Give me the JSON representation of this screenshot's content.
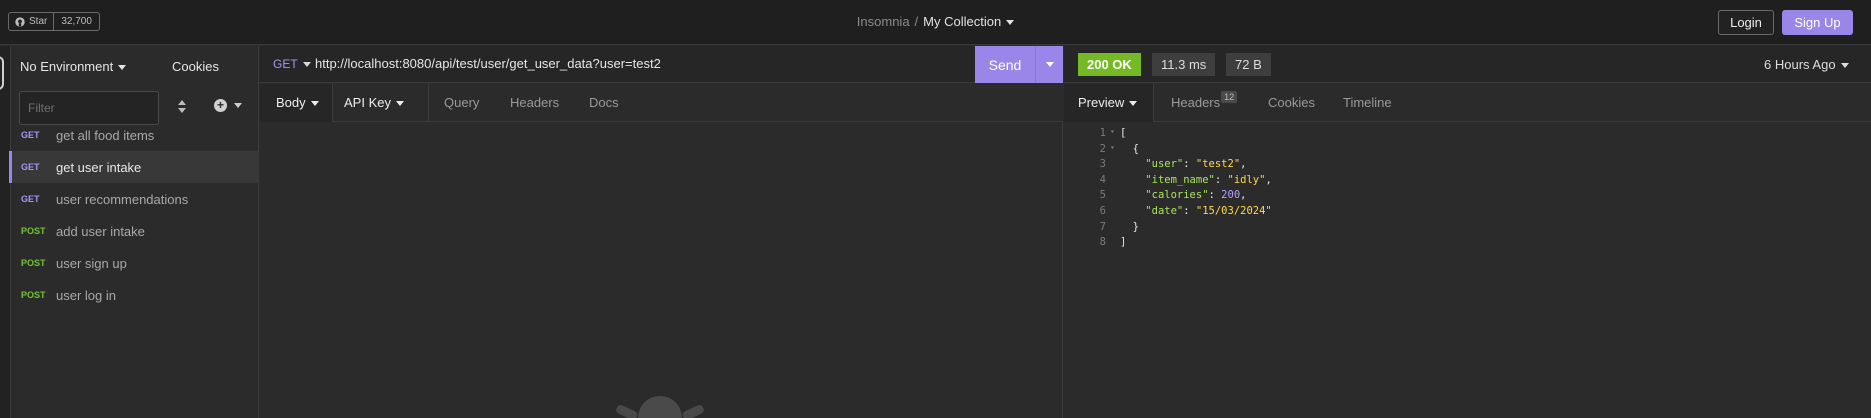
{
  "header": {
    "github_star_label": "Star",
    "github_star_count": "32,700",
    "workspace": "Insomnia",
    "separator": "/",
    "collection": "My Collection",
    "login": "Login",
    "signup": "Sign Up",
    "accent_color": "#9a86e8"
  },
  "sidebar": {
    "environment": "No Environment",
    "cookies": "Cookies",
    "filter_placeholder": "Filter",
    "requests": [
      {
        "method": "GET",
        "name": "get all food items"
      },
      {
        "method": "GET",
        "name": "get user intake"
      },
      {
        "method": "GET",
        "name": "user recommendations"
      },
      {
        "method": "POST",
        "name": "add user intake"
      },
      {
        "method": "POST",
        "name": "user sign up"
      },
      {
        "method": "POST",
        "name": "user log in"
      }
    ],
    "active_index": 1
  },
  "request": {
    "method": "GET",
    "url": "http://localhost:8080/api/test/user/get_user_data?user=test2",
    "send": "Send",
    "tabs": {
      "body": "Body",
      "auth": "API Key",
      "query": "Query",
      "headers": "Headers",
      "docs": "Docs"
    }
  },
  "response": {
    "status": "200 OK",
    "time": "11.3 ms",
    "size": "72 B",
    "age": "6 Hours Ago",
    "tabs": {
      "preview": "Preview",
      "headers": "Headers",
      "headers_count": "12",
      "cookies": "Cookies",
      "timeline": "Timeline"
    },
    "body": {
      "line_numbers": [
        "1",
        "2",
        "3",
        "4",
        "5",
        "6",
        "7",
        "8"
      ],
      "open_bracket": "[",
      "open_brace": "{",
      "fields": [
        {
          "key": "\"user\"",
          "value": "\"test2\"",
          "type": "string"
        },
        {
          "key": "\"item_name\"",
          "value": "\"idly\"",
          "type": "string"
        },
        {
          "key": "\"calories\"",
          "value": "200",
          "type": "number"
        },
        {
          "key": "\"date\"",
          "value": "\"15/03/2024\"",
          "type": "string"
        }
      ],
      "close_brace": "}",
      "close_bracket": "]"
    }
  }
}
